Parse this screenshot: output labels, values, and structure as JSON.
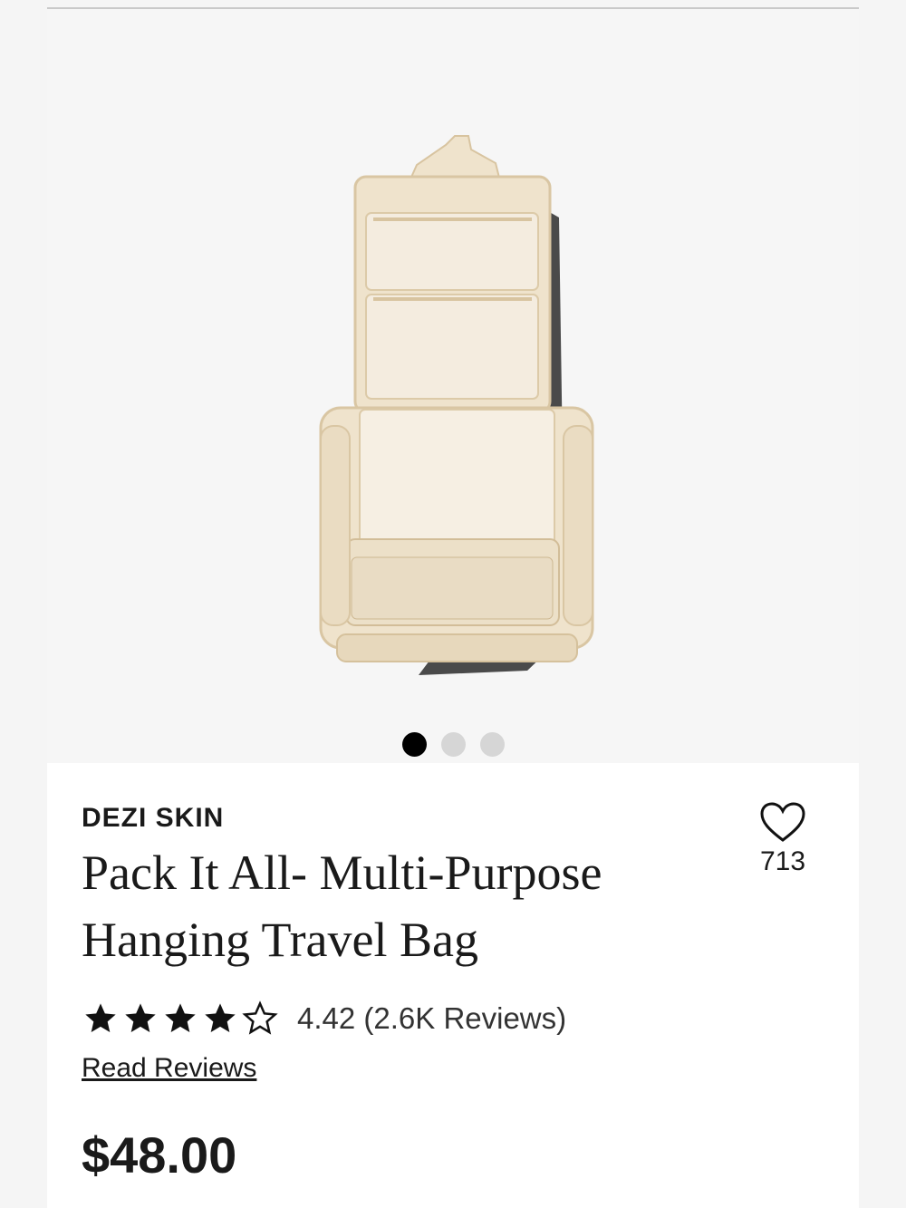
{
  "gallery": {
    "image_alt": "Pack It All- Multi-Purpose Hanging Travel Bag product image",
    "slides": 3,
    "active_slide": 1
  },
  "product": {
    "brand": "DEZI SKIN",
    "title": "Pack It All- Multi-Purpose Hanging Travel Bag",
    "favorites_count": "713",
    "rating_value": 4.42,
    "rating_text": "4.42 (2.6K Reviews)",
    "read_reviews_label": "Read Reviews",
    "price": "$48.00"
  },
  "colors": {
    "bag_body": "#efe3cc",
    "bag_trim": "#e6d4b4",
    "dot_active": "#000000",
    "dot_inactive": "#d6d6d6"
  }
}
